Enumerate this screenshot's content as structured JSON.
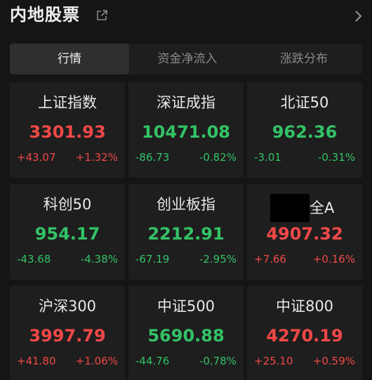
{
  "header": {
    "title": "内地股票",
    "share_icon": "share-icon",
    "more_icon": "chevron-right-icon"
  },
  "tabs": [
    {
      "label": "行情",
      "active": true
    },
    {
      "label": "资金净流入",
      "active": false
    },
    {
      "label": "涨跌分布",
      "active": false
    }
  ],
  "colors": {
    "up": "#f04848",
    "down": "#33c266",
    "background": "#151515",
    "card": "#1e1e1e"
  },
  "indices": [
    {
      "name": "上证指数",
      "price": "3301.93",
      "change": "+43.07",
      "pct": "+1.32%",
      "direction": "up"
    },
    {
      "name": "深证成指",
      "price": "10471.08",
      "change": "-86.73",
      "pct": "-0.82%",
      "direction": "down"
    },
    {
      "name": "北证50",
      "price": "962.36",
      "change": "-3.01",
      "pct": "-0.31%",
      "direction": "down"
    },
    {
      "name": "科创50",
      "price": "954.17",
      "change": "-43.68",
      "pct": "-4.38%",
      "direction": "down"
    },
    {
      "name": "创业板指",
      "price": "2212.91",
      "change": "-67.19",
      "pct": "-2.95%",
      "direction": "down"
    },
    {
      "name": "全A",
      "price": "4907.32",
      "change": "+7.66",
      "pct": "+0.16%",
      "direction": "up",
      "redacted_prefix": true
    },
    {
      "name": "沪深300",
      "price": "3997.79",
      "change": "+41.80",
      "pct": "+1.06%",
      "direction": "up"
    },
    {
      "name": "中证500",
      "price": "5690.88",
      "change": "-44.76",
      "pct": "-0.78%",
      "direction": "down"
    },
    {
      "name": "中证800",
      "price": "4270.19",
      "change": "+25.10",
      "pct": "+0.59%",
      "direction": "up"
    }
  ]
}
